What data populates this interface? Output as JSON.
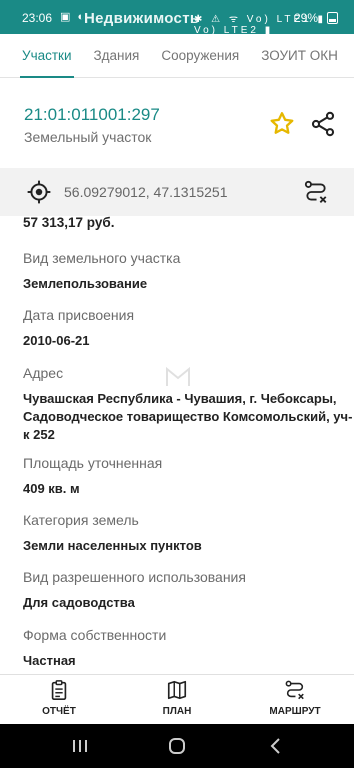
{
  "status_bar": {
    "time": "23:06",
    "left_icons": "▣ ◐",
    "app_title": "Недвижимость",
    "right_icons": "✱ ⚠ ᯤ Vo) LTE1 ▮ Vo) LTE2 ▮",
    "battery": "29%"
  },
  "tabs": [
    {
      "label": "Участки",
      "active": true
    },
    {
      "label": "Здания",
      "active": false
    },
    {
      "label": "Сооружения",
      "active": false
    },
    {
      "label": "ЗОУИТ ОКН",
      "active": false
    }
  ],
  "parcel": {
    "cadastral_number": "21:01:011001:297",
    "type": "Земельный участок"
  },
  "coords": {
    "value": "56.09279012, 47.1315251"
  },
  "details": {
    "price": "57 313,17 руб.",
    "fields": [
      {
        "label": "Вид земельного участка",
        "value": "Землепользование"
      },
      {
        "label": "Дата присвоения",
        "value": "2010-06-21"
      },
      {
        "label": "Адрес",
        "value": "Чувашская Республика - Чувашия, г. Чебоксары, Садоводческое товарищество Комсомольский, уч-к 252"
      },
      {
        "label": "Площадь уточненная",
        "value": "409 кв. м"
      },
      {
        "label": "Категория земель",
        "value": "Земли населенных пунктов"
      },
      {
        "label": "Вид разрешенного использования",
        "value": "Для садоводства"
      },
      {
        "label": "Форма собственности",
        "value": "Частная"
      }
    ]
  },
  "bottom_nav": {
    "report": "ОТЧЁТ",
    "plan": "ПЛАН",
    "route": "МАРШРУТ"
  },
  "colors": {
    "accent": "#1a8a86",
    "star": "#e6b800"
  }
}
